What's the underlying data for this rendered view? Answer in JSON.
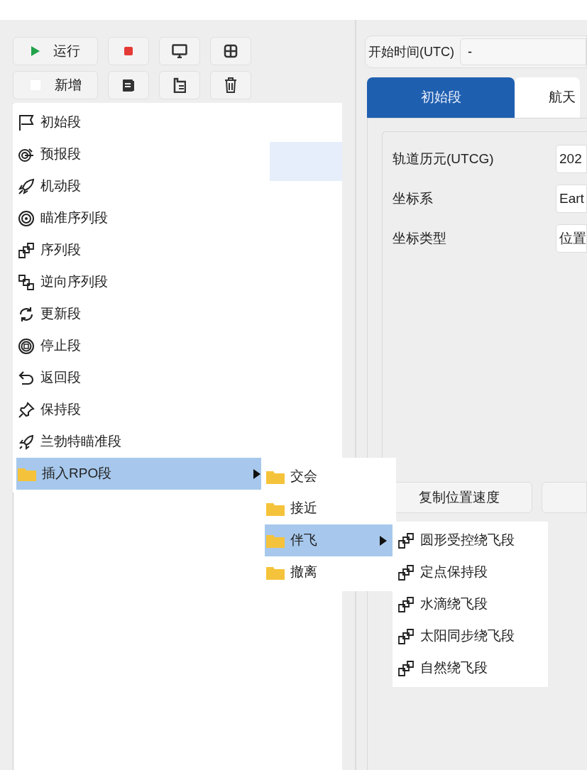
{
  "toolbar": {
    "buttons": [
      {
        "kind": "run",
        "label": "运行"
      },
      {
        "kind": "stop"
      },
      {
        "kind": "monitor"
      },
      {
        "kind": "grid"
      },
      {
        "kind": "add",
        "label": "新增"
      },
      {
        "kind": "copy"
      },
      {
        "kind": "paste"
      },
      {
        "kind": "delete"
      }
    ]
  },
  "tree": {
    "rows": [
      {
        "selected": true
      }
    ]
  },
  "menu": {
    "items": [
      {
        "label": "初始段",
        "selected": false
      },
      {
        "label": "预报段",
        "selected": false
      },
      {
        "label": "机动段",
        "selected": false
      },
      {
        "label": "瞄准序列段",
        "selected": false
      },
      {
        "label": "序列段",
        "selected": false
      },
      {
        "label": "逆向序列段",
        "selected": false
      },
      {
        "label": "更新段",
        "selected": false
      },
      {
        "label": "停止段",
        "selected": false
      },
      {
        "label": "返回段",
        "selected": false
      },
      {
        "label": "保持段",
        "selected": false
      },
      {
        "label": "兰勃特瞄准段",
        "selected": false
      },
      {
        "label": "插入RPO段",
        "selected": true,
        "submenu": [
          {
            "label": "交会",
            "selected": false
          },
          {
            "label": "接近",
            "selected": false
          },
          {
            "label": "伴飞",
            "selected": true,
            "submenu": [
              {
                "label": "圆形受控绕飞段"
              },
              {
                "label": "定点保持段"
              },
              {
                "label": "水滴绕飞段"
              },
              {
                "label": "太阳同步绕飞段"
              },
              {
                "label": "自然绕飞段"
              }
            ]
          },
          {
            "label": "撤离",
            "selected": false
          }
        ]
      }
    ]
  },
  "start_time": {
    "label": "开始时间(UTC)",
    "value": "-"
  },
  "tabs": [
    {
      "label": "初始段",
      "selected": true
    },
    {
      "label": "航天",
      "selected": false
    }
  ],
  "form": {
    "fields": [
      {
        "label": "轨道历元(UTCG)",
        "value": "202"
      },
      {
        "label": "坐标系",
        "value": "Eart"
      },
      {
        "label": "坐标类型",
        "value": "位置"
      }
    ]
  },
  "buttons": [
    {
      "kind": "text",
      "label": "复制位置速度"
    },
    {
      "kind": "blank"
    }
  ]
}
